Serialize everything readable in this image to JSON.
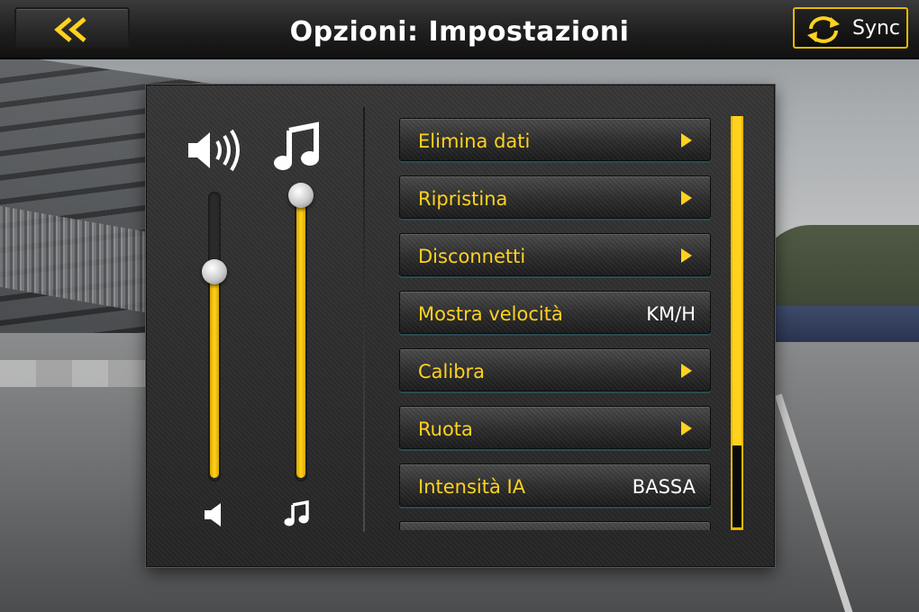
{
  "header": {
    "title": "Opzioni: Impostazioni",
    "back_icon": "double-chevron-left-icon",
    "sync_label": "Sync",
    "sync_icon": "refresh-icon"
  },
  "audio": {
    "sound_volume_icon": "speaker-icon",
    "music_volume_icon": "music-note-icon",
    "sound_level": 0.73,
    "music_level": 1.0
  },
  "menu": {
    "items": [
      {
        "label": "Elimina dati",
        "value": "",
        "has_arrow": true
      },
      {
        "label": "Ripristina",
        "value": "",
        "has_arrow": true
      },
      {
        "label": "Disconnetti",
        "value": "",
        "has_arrow": true
      },
      {
        "label": "Mostra velocità",
        "value": "KM/H",
        "has_arrow": false
      },
      {
        "label": "Calibra",
        "value": "",
        "has_arrow": true
      },
      {
        "label": "Ruota",
        "value": "",
        "has_arrow": true
      },
      {
        "label": "Intensità IA",
        "value": "BASSA",
        "has_arrow": false
      },
      {
        "label": "",
        "value": "",
        "has_arrow": false
      }
    ]
  },
  "scroll_position": 0.0,
  "colors": {
    "accent": "#ffd21f",
    "accent_border": "#e9b800",
    "text": "#ffffff"
  }
}
